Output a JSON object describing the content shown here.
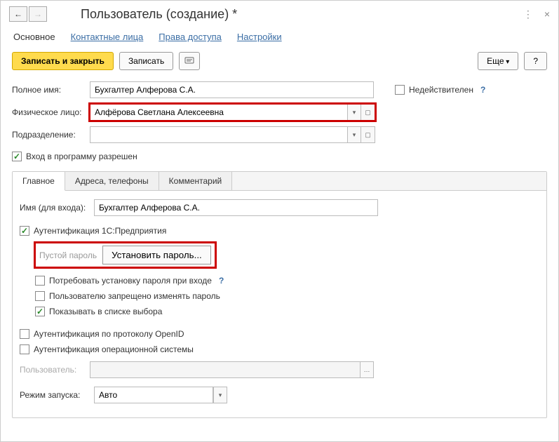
{
  "window": {
    "title": "Пользователь (создание) *"
  },
  "navTabs": {
    "main": "Основное",
    "contacts": "Контактные лица",
    "rights": "Права доступа",
    "settings": "Настройки"
  },
  "toolbar": {
    "saveClose": "Записать и закрыть",
    "save": "Записать",
    "more": "Еще",
    "help": "?"
  },
  "form": {
    "fullNameLabel": "Полное имя:",
    "fullName": "Бухгалтер Алферова С.А.",
    "inactiveLabel": "Недействителен",
    "personLabel": "Физическое лицо:",
    "person": "Алфёрова Светлана Алексеевна",
    "departmentLabel": "Подразделение:",
    "department": "",
    "loginAllowedLabel": "Вход в программу разрешен"
  },
  "tabs": {
    "main": "Главное",
    "addresses": "Адреса, телефоны",
    "comment": "Комментарий"
  },
  "mainTab": {
    "loginNameLabel": "Имя (для входа):",
    "loginName": "Бухгалтер Алферова С.А.",
    "auth1cLabel": "Аутентификация 1С:Предприятия",
    "emptyPassword": "Пустой пароль",
    "setPassword": "Установить пароль...",
    "requirePassLabel": "Потребовать установку пароля при входе",
    "denyChangeLabel": "Пользователю запрещено изменять пароль",
    "showInListLabel": "Показывать в списке выбора",
    "authOpenIdLabel": "Аутентификация по протоколу OpenID",
    "authOsLabel": "Аутентификация операционной системы",
    "osUserLabel": "Пользователь:",
    "osUser": "",
    "launchModeLabel": "Режим запуска:",
    "launchMode": "Авто"
  }
}
